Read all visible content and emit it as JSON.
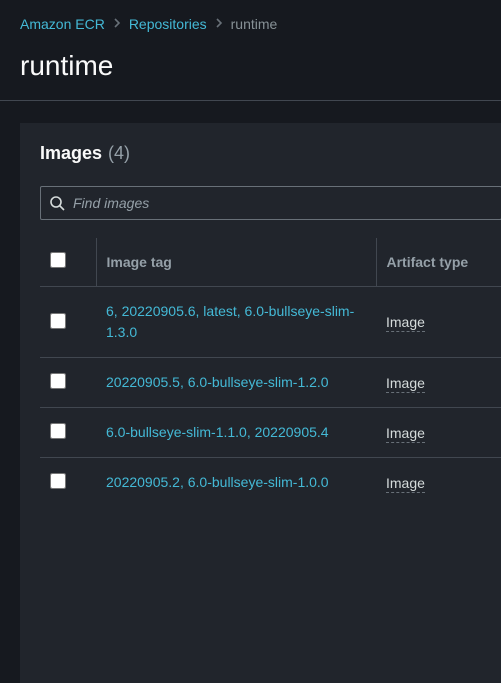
{
  "breadcrumb": {
    "root": "Amazon ECR",
    "repos": "Repositories",
    "current": "runtime"
  },
  "title": "runtime",
  "panel": {
    "title": "Images",
    "count": "(4)"
  },
  "search": {
    "placeholder": "Find images"
  },
  "table": {
    "headers": {
      "tag": "Image tag",
      "type": "Artifact type"
    },
    "rows": [
      {
        "tag": "6, 20220905.6, latest, 6.0-bullseye-slim-1.3.0",
        "type": "Image"
      },
      {
        "tag": "20220905.5, 6.0-bullseye-slim-1.2.0",
        "type": "Image"
      },
      {
        "tag": "6.0-bullseye-slim-1.1.0, 20220905.4",
        "type": "Image"
      },
      {
        "tag": "20220905.2, 6.0-bullseye-slim-1.0.0",
        "type": "Image"
      }
    ]
  }
}
